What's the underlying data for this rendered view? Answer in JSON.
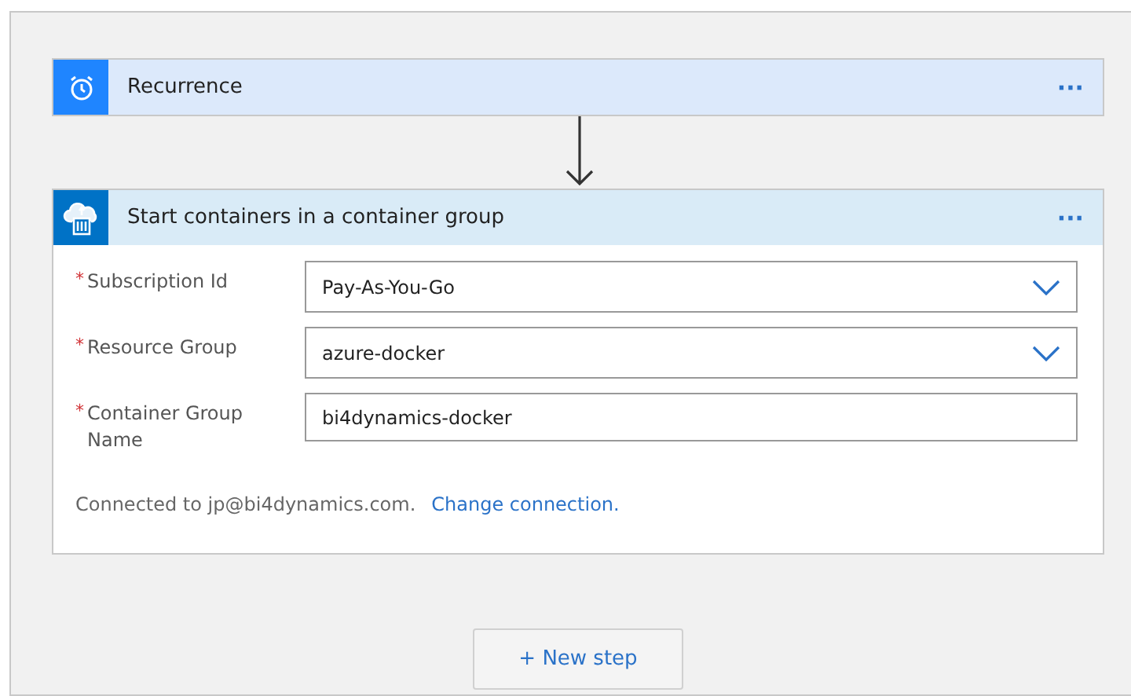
{
  "steps": [
    {
      "kind": "trigger",
      "title": "Recurrence",
      "menu": "···"
    },
    {
      "kind": "action",
      "title": "Start containers in a container group",
      "menu": "···",
      "fields": [
        {
          "kind": "dropdown",
          "marker": "*",
          "label": "Subscription Id",
          "value": "Pay-As-You-Go"
        },
        {
          "kind": "dropdown",
          "marker": "*",
          "label": "Resource Group",
          "value": "azure-docker"
        },
        {
          "kind": "text",
          "marker": "*",
          "label": "Container Group Name",
          "value": "bi4dynamics-docker"
        }
      ],
      "connection": {
        "text": "Connected to jp@bi4dynamics.com.",
        "link": "Change connection."
      }
    }
  ],
  "new_step": "+ New step"
}
